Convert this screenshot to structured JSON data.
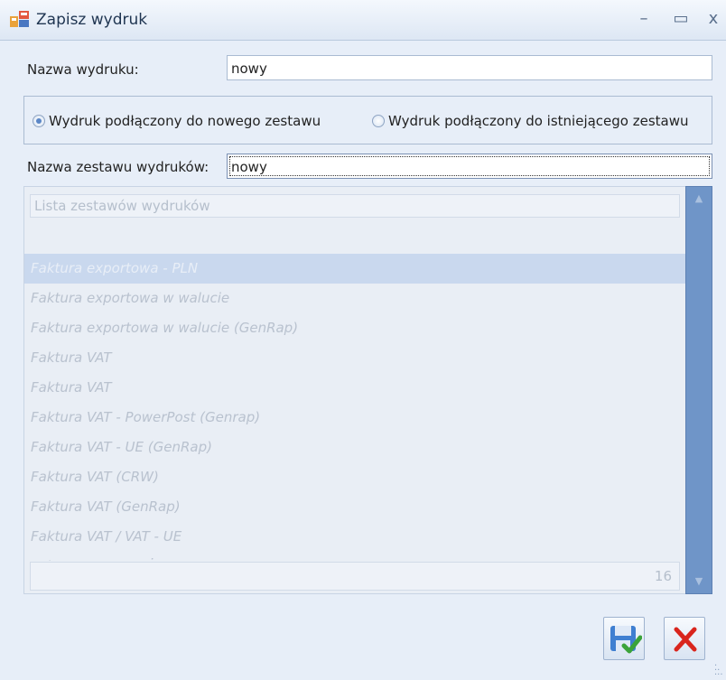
{
  "window": {
    "title": "Zapisz wydruk",
    "minimize_glyph": "–",
    "maximize_glyph": "▭",
    "close_glyph": "x",
    "app_icon": "window-app-icon"
  },
  "form": {
    "print_name_label": "Nazwa wydruku:",
    "print_name_value": "nowy",
    "radio_new": "Wydruk podłączony do nowego zestawu",
    "radio_existing": "Wydruk podłączony do istniejącego zestawu",
    "radio_selected": "new",
    "set_name_label": "Nazwa zestawu wydruków:",
    "set_name_value": "nowy"
  },
  "list": {
    "header": "Lista zestawów wydruków",
    "items": [
      "Faktura exportowa - PLN",
      "Faktura exportowa w walucie",
      "Faktura exportowa w walucie (GenRap)",
      "Faktura VAT",
      "Faktura VAT",
      "Faktura VAT - PowerPost (Genrap)",
      "Faktura VAT - UE (GenRap)",
      "Faktura VAT (CRW)",
      "Faktura VAT (GenRap)",
      "Faktura VAT / VAT - UE",
      "Faktura VAT MARŻA"
    ],
    "selected_index": 0,
    "count": "16"
  },
  "buttons": {
    "save_icon": "save-check-icon",
    "cancel_icon": "red-x-icon"
  },
  "colors": {
    "accent": "#6f95c8",
    "selection": "#c9d8ee",
    "cancel_red": "#d9251d"
  }
}
